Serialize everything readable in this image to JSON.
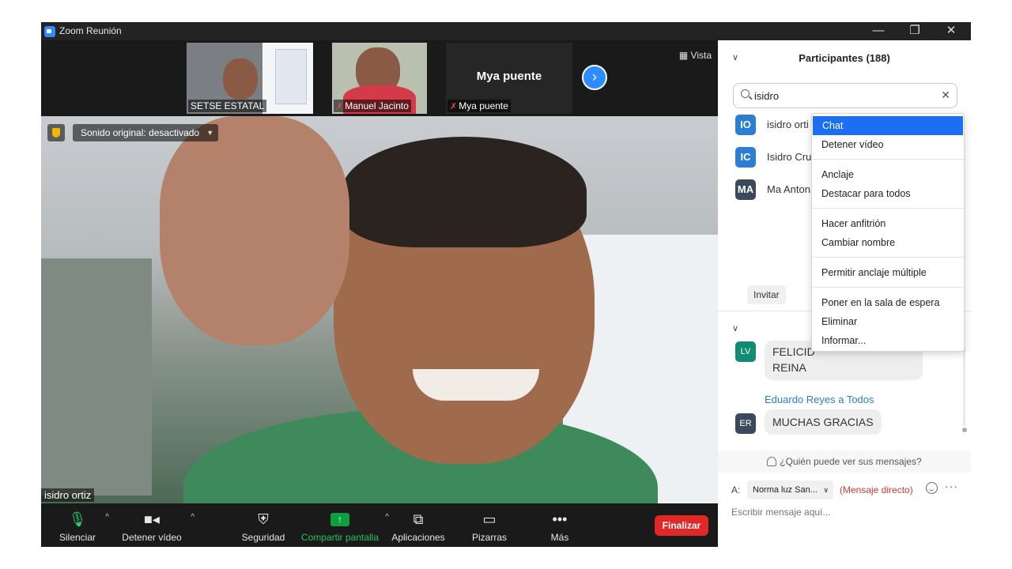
{
  "window": {
    "title": "Zoom Reunión",
    "controls": {
      "minimize": "—",
      "restore": "❐",
      "close": "✕"
    }
  },
  "thumbnails": [
    {
      "name": "SETSE ESTATAL",
      "muted": false
    },
    {
      "name": "Manuel Jacinto",
      "muted": true
    },
    {
      "name": "Mya puente",
      "muted": true,
      "display_name": "Mya puente"
    }
  ],
  "view_label": "Vista",
  "main_video": {
    "audio_status": "Sonido original: desactivado",
    "speaker_name": "isidro ortiz"
  },
  "toolbar": {
    "mute": "Silenciar",
    "stop_video": "Detener vídeo",
    "security": "Seguridad",
    "share_screen": "Compartir pantalla",
    "apps": "Aplicaciones",
    "whiteboards": "Pizarras",
    "more": "Más",
    "end": "Finalizar"
  },
  "participants": {
    "title": "Participantes (188)",
    "search_value": "isidro",
    "list": [
      {
        "initials": "IO",
        "name": "isidro orti",
        "color": "#2d7dd2"
      },
      {
        "initials": "IC",
        "name": "Isidro Cru",
        "color": "#2d7dd2"
      },
      {
        "initials": "MA",
        "name": "Ma Anton",
        "color": "#3a4a5c"
      }
    ],
    "invite": "Invitar"
  },
  "chat": {
    "messages": [
      {
        "initials": "LV",
        "color": "#138a72",
        "text_line1": "FELICID",
        "text_line2": "REINA"
      },
      {
        "initials": "ER",
        "color": "#3a4a5c",
        "text": "MUCHAS GRACIAS"
      }
    ],
    "sender": "Eduardo Reyes a Todos",
    "who_can_see": "¿Quién puede ver sus mensajes?",
    "to_label": "A:",
    "recipient": "Norma luz San...",
    "direct": "(Mensaje directo)",
    "placeholder": "Escribir mensaje aquí..."
  },
  "context_menu": {
    "items": [
      "Chat",
      "Detener vídeo",
      "Anclaje",
      "Destacar para todos",
      "Hacer anfitrión",
      "Cambiar nombre",
      "Permitir anclaje múltiple",
      "Poner en la sala de espera",
      "Eliminar",
      "Informar..."
    ]
  },
  "colors": {
    "accent": "#2d8cff",
    "share_green": "#0e9f3e",
    "end_red": "#e02828",
    "menu_highlight": "#1b6ff5"
  }
}
